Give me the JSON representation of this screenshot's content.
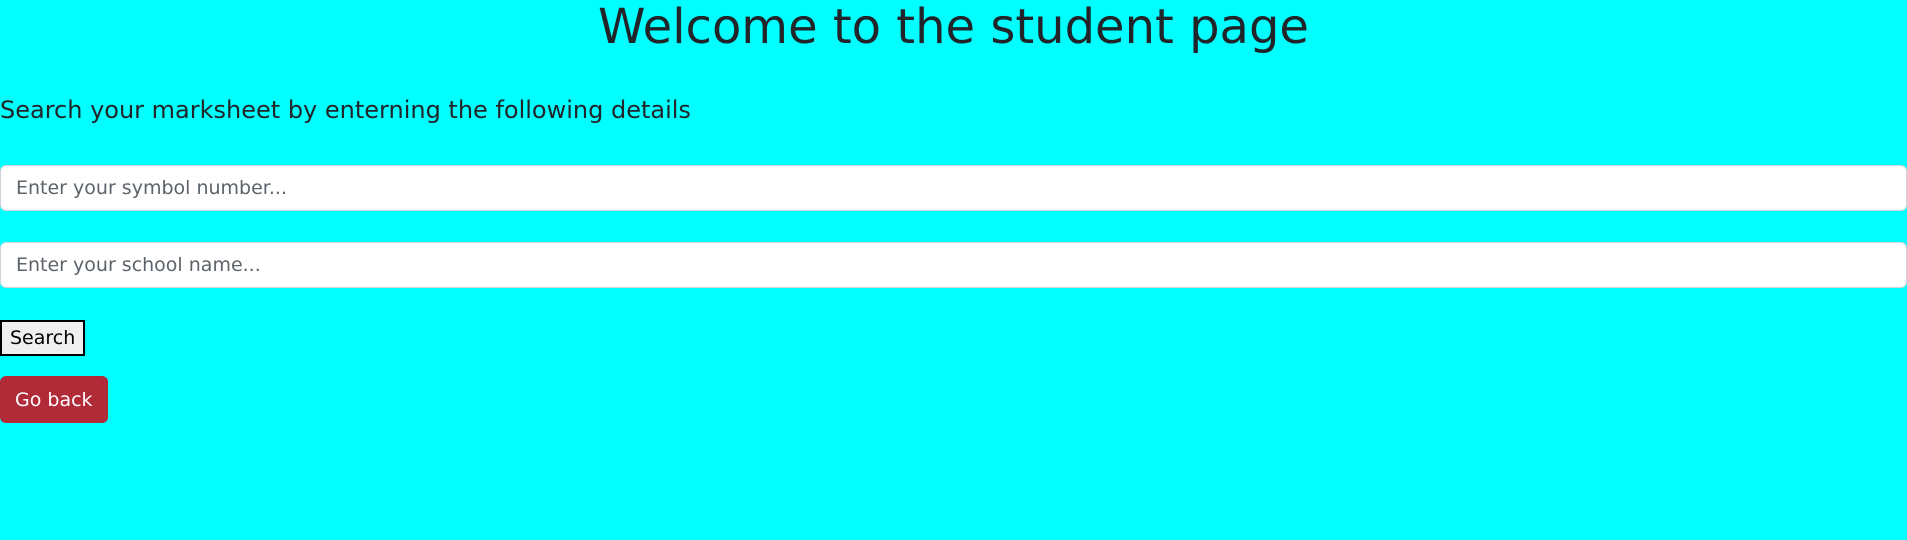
{
  "header": {
    "title": "Welcome to the student page"
  },
  "form": {
    "instruction": "Search your marksheet by enterning the following details",
    "symbol_number": {
      "placeholder": "Enter your symbol number...",
      "value": ""
    },
    "school_name": {
      "placeholder": "Enter your school name...",
      "value": ""
    },
    "search_label": "Search"
  },
  "navigation": {
    "go_back_label": "Go back"
  },
  "colors": {
    "page_background": "#00ffff",
    "go_back_button": "#b02a37",
    "input_background": "#ffffff"
  }
}
